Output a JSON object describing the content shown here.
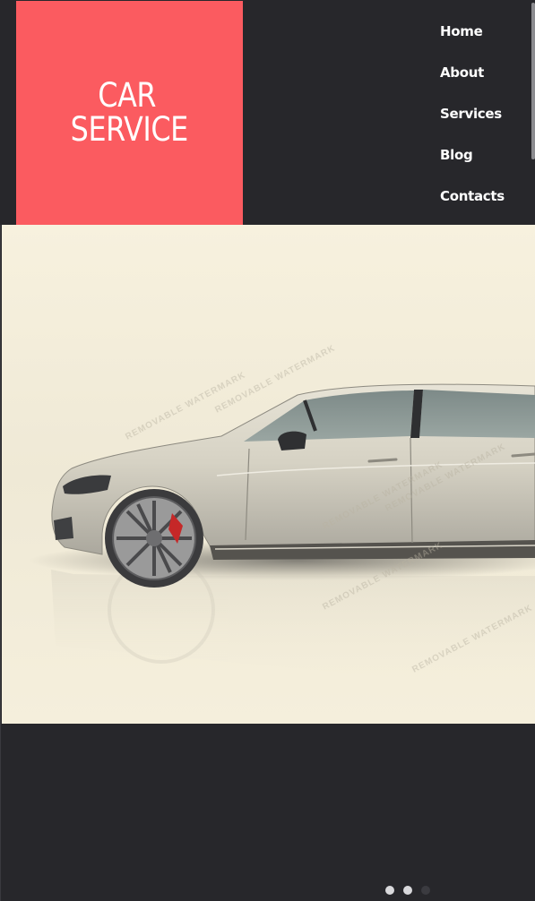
{
  "brand": {
    "line1": "CAR",
    "line2": "SERVICE",
    "color": "#fb5b60"
  },
  "nav": {
    "items": [
      {
        "label": "Home"
      },
      {
        "label": "About"
      },
      {
        "label": "Services"
      },
      {
        "label": "Blog"
      },
      {
        "label": "Contacts"
      }
    ]
  },
  "hero": {
    "watermark": "REMOVABLE WATERMARK"
  },
  "slider": {
    "total_slides": 3,
    "active_index": 2
  },
  "colors": {
    "background": "#27272b",
    "hero_background": "#f7f1de",
    "accent": "#fb5b60"
  }
}
